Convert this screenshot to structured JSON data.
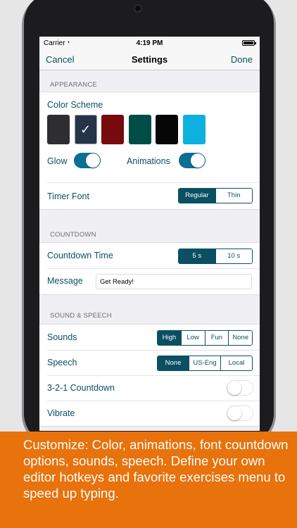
{
  "status_bar": {
    "carrier": "Carrier",
    "time": "4:19 PM",
    "battery_percent": 100
  },
  "nav": {
    "cancel": "Cancel",
    "title": "Settings",
    "done": "Done"
  },
  "appearance": {
    "header": "APPEARANCE",
    "color_scheme_label": "Color Scheme",
    "swatches": [
      {
        "color": "#2e2e30",
        "selected": false
      },
      {
        "color": "#253447",
        "selected": true,
        "mark": "✓"
      },
      {
        "color": "#770a0c",
        "selected": false
      },
      {
        "color": "#004d47",
        "selected": false
      },
      {
        "color": "#060606",
        "selected": false
      },
      {
        "color": "#0cb1e0",
        "selected": false
      }
    ],
    "glow_label": "Glow",
    "glow_on": true,
    "animations_label": "Animations",
    "animations_on": true,
    "timer_font_label": "Timer Font",
    "timer_font_options": [
      "Regular",
      "Thin"
    ],
    "timer_font_selected": "Regular"
  },
  "countdown": {
    "header": "COUNTDOWN",
    "time_label": "Countdown Time",
    "time_options": [
      "5 s",
      "10 s"
    ],
    "time_selected": "5 s",
    "message_label": "Message",
    "message_value": "Get Ready!"
  },
  "sound_speech": {
    "header": "SOUND & SPEECH",
    "sounds_label": "Sounds",
    "sounds_options": [
      "High",
      "Low",
      "Fun",
      "None"
    ],
    "sounds_selected": "High",
    "speech_label": "Speech",
    "speech_options": [
      "None",
      "US-Eng",
      "Local"
    ],
    "speech_selected": "None",
    "countdown_321_label": "3-2-1 Countdown",
    "countdown_321_on": false,
    "vibrate_label": "Vibrate",
    "vibrate_on": false
  },
  "banner": {
    "text": "Customize: Color, animations, font countdown options, sounds, speech. Define your own editor hotkeys and favorite exercises menu to speed up typing."
  },
  "colors": {
    "accent": "#0b4f63",
    "switch_on": "#0b6f94",
    "banner": "#e8720c"
  }
}
